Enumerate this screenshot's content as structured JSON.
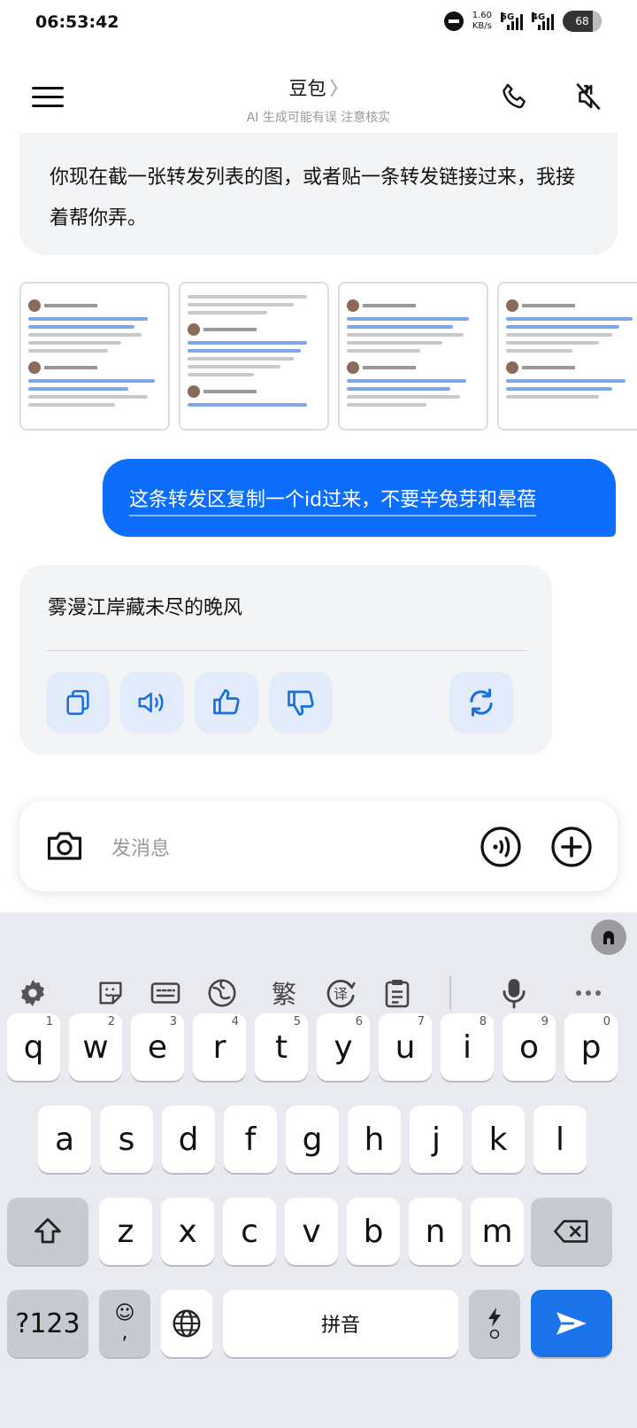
{
  "status_bar": {
    "time": "06:53:42",
    "net_speed_value": "1.60",
    "net_speed_unit": "KB/s",
    "sim1_label": "5G",
    "sim2_label": "4G",
    "battery": "68"
  },
  "header": {
    "title": "豆包",
    "title_chevron": "〉",
    "subtitle": "AI 生成可能有误  注意核实"
  },
  "ai_message": {
    "text": "你现在截一张转发列表的图，或者贴一条转发链接过来，我接着帮你弄。"
  },
  "user_message": {
    "text": "这条转发区复制一个id过来，不要辛兔芽和晕蓓"
  },
  "reply": {
    "text": "雾漫江岸藏未尽的晚风",
    "actions": [
      "copy-icon",
      "speaker-icon",
      "thumbs-up-icon",
      "thumbs-down-icon",
      "regenerate-icon"
    ]
  },
  "input_bar": {
    "placeholder": "发消息"
  },
  "keyboard": {
    "toolbar_trad": "繁",
    "row1": [
      {
        "key": "q",
        "hint": "1"
      },
      {
        "key": "w",
        "hint": "2"
      },
      {
        "key": "e",
        "hint": "3"
      },
      {
        "key": "r",
        "hint": "4"
      },
      {
        "key": "t",
        "hint": "5"
      },
      {
        "key": "y",
        "hint": "6"
      },
      {
        "key": "u",
        "hint": "7"
      },
      {
        "key": "i",
        "hint": "8"
      },
      {
        "key": "o",
        "hint": "9"
      },
      {
        "key": "p",
        "hint": "0"
      }
    ],
    "row2": [
      "a",
      "s",
      "d",
      "f",
      "g",
      "h",
      "j",
      "k",
      "l"
    ],
    "row3": [
      "z",
      "x",
      "c",
      "v",
      "b",
      "n",
      "m"
    ],
    "symbols_label": "?123",
    "emoji_label": "☺",
    "comma_label": ",",
    "space_label": "拼音"
  },
  "colors": {
    "accent": "#0d6efd",
    "action_bg": "#e2ebf9",
    "card_bg": "#f3f4f6",
    "keyboard_bg": "#e8eaf0"
  }
}
